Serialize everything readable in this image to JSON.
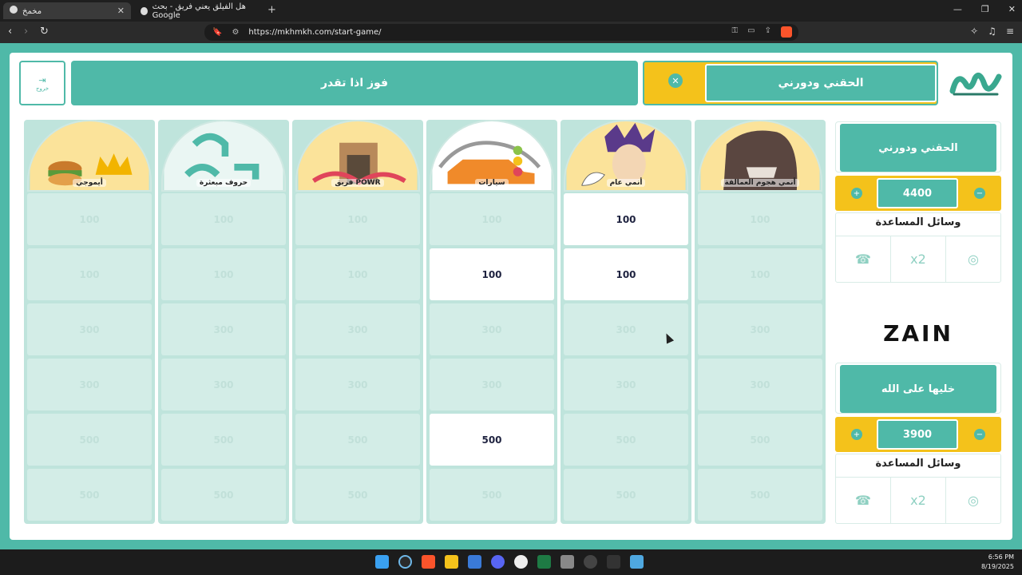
{
  "browser": {
    "tabs": [
      {
        "title": "مخمخ",
        "active": true
      },
      {
        "title": "هل الفيلق يعني فريق - بحث Google",
        "active": false
      }
    ],
    "url": "https://mkhmkh.com/start-game/"
  },
  "header": {
    "exit_label": "خروج",
    "win_banner": "فوز اذا تقدر",
    "current_team": "الحقني ودورني",
    "logo_text": "مخمخ"
  },
  "board": {
    "columns": [
      {
        "category": "أيموجي",
        "cells": [
          {
            "value": "100",
            "state": "used"
          },
          {
            "value": "100",
            "state": "used"
          },
          {
            "value": "300",
            "state": "used"
          },
          {
            "value": "300",
            "state": "used"
          },
          {
            "value": "500",
            "state": "used"
          },
          {
            "value": "500",
            "state": "used"
          }
        ]
      },
      {
        "category": "حروف مبعثرة",
        "cells": [
          {
            "value": "100",
            "state": "used"
          },
          {
            "value": "100",
            "state": "used"
          },
          {
            "value": "300",
            "state": "used"
          },
          {
            "value": "300",
            "state": "used"
          },
          {
            "value": "500",
            "state": "used"
          },
          {
            "value": "500",
            "state": "used"
          }
        ]
      },
      {
        "category": "فريق POWR",
        "cells": [
          {
            "value": "100",
            "state": "used"
          },
          {
            "value": "100",
            "state": "used"
          },
          {
            "value": "300",
            "state": "used"
          },
          {
            "value": "300",
            "state": "used"
          },
          {
            "value": "500",
            "state": "used"
          },
          {
            "value": "500",
            "state": "used"
          }
        ]
      },
      {
        "category": "سيارات",
        "cells": [
          {
            "value": "100",
            "state": "used"
          },
          {
            "value": "100",
            "state": "open"
          },
          {
            "value": "300",
            "state": "used"
          },
          {
            "value": "300",
            "state": "used"
          },
          {
            "value": "500",
            "state": "open"
          },
          {
            "value": "500",
            "state": "used"
          }
        ]
      },
      {
        "category": "أنمي عام",
        "cells": [
          {
            "value": "100",
            "state": "open"
          },
          {
            "value": "100",
            "state": "open"
          },
          {
            "value": "300",
            "state": "used"
          },
          {
            "value": "300",
            "state": "used"
          },
          {
            "value": "500",
            "state": "used"
          },
          {
            "value": "500",
            "state": "used"
          }
        ]
      },
      {
        "category": "أنمي هجوم العمالقة",
        "cells": [
          {
            "value": "100",
            "state": "used"
          },
          {
            "value": "100",
            "state": "used"
          },
          {
            "value": "300",
            "state": "used"
          },
          {
            "value": "300",
            "state": "used"
          },
          {
            "value": "500",
            "state": "used"
          },
          {
            "value": "500",
            "state": "used"
          }
        ]
      }
    ]
  },
  "teams": [
    {
      "name": "الحقني ودورني",
      "score": "4400",
      "aids_title": "وسائل المساعدة"
    },
    {
      "name": "خليها على الله",
      "score": "3900",
      "aids_title": "وسائل المساعدة"
    }
  ],
  "sponsor": "ZAIN",
  "taskbar": {
    "time": "6:56 PM",
    "date": "8/19/2025"
  },
  "colors": {
    "accent": "#4fb9a8",
    "yellow": "#f4c21b",
    "used_cell": "#d3ede7"
  }
}
